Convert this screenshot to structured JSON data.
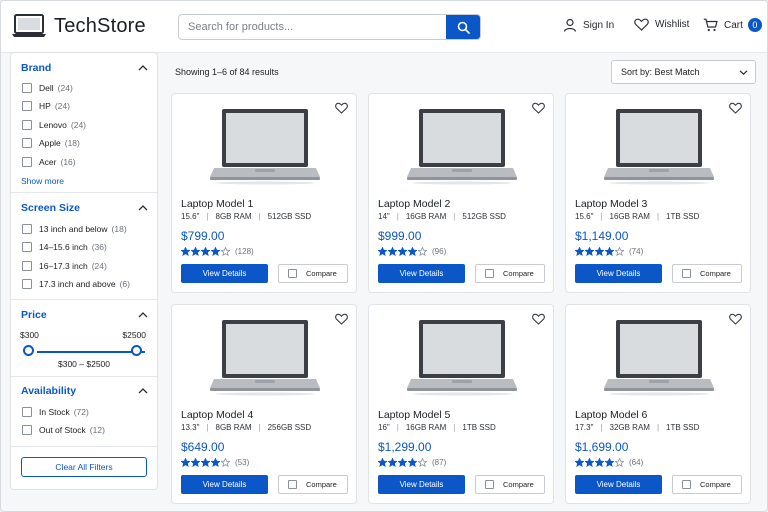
{
  "header": {
    "logo_text": "TechStore",
    "search_placeholder": "Search for products...",
    "sign_in": "Sign In",
    "wishlist": "Wishlist",
    "cart": "Cart",
    "cart_count": "0",
    "brand_color": "#0b57c7"
  },
  "sidebar": {
    "brand": {
      "title": "Brand",
      "items": [
        {
          "label": "Dell",
          "count": "(24)"
        },
        {
          "label": "HP",
          "count": "(24)"
        },
        {
          "label": "Lenovo",
          "count": "(24)"
        },
        {
          "label": "Apple",
          "count": "(18)"
        },
        {
          "label": "Acer",
          "count": "(16)"
        }
      ],
      "show_more": "Show more"
    },
    "screen_size": {
      "title": "Screen Size",
      "items": [
        {
          "label": "13 inch and below",
          "count": "(18)"
        },
        {
          "label": "14–15.6 inch",
          "count": "(36)"
        },
        {
          "label": "16–17.3 inch",
          "count": "(24)"
        },
        {
          "label": "17.3 inch and above",
          "count": "(6)"
        }
      ]
    },
    "price": {
      "title": "Price",
      "min_label": "$300",
      "max_label": "$2500",
      "range_text": "$300 – $2500"
    },
    "availability": {
      "title": "Availability",
      "items": [
        {
          "label": "In Stock",
          "count": "(72)"
        },
        {
          "label": "Out of Stock",
          "count": "(12)"
        }
      ]
    },
    "clear_all": "Clear All Filters"
  },
  "main": {
    "results_text": "Showing 1–6 of 84 results",
    "sort_label": "Sort by: Best Match",
    "view_details": "View Details",
    "compare": "Compare",
    "products": [
      {
        "name": "Laptop Model 1",
        "screen": "15.6\"",
        "ram": "8GB RAM",
        "storage": "512GB SSD",
        "price": "$799.00",
        "stars": 4,
        "reviews": "(128)"
      },
      {
        "name": "Laptop Model 2",
        "screen": "14\"",
        "ram": "16GB RAM",
        "storage": "512GB SSD",
        "price": "$999.00",
        "stars": 4,
        "reviews": "(96)"
      },
      {
        "name": "Laptop Model 3",
        "screen": "15.6\"",
        "ram": "16GB RAM",
        "storage": "1TB SSD",
        "price": "$1,149.00",
        "stars": 4,
        "reviews": "(74)"
      },
      {
        "name": "Laptop Model 4",
        "screen": "13.3\"",
        "ram": "8GB RAM",
        "storage": "256GB SSD",
        "price": "$649.00",
        "stars": 4,
        "reviews": "(53)"
      },
      {
        "name": "Laptop Model 5",
        "screen": "16\"",
        "ram": "16GB RAM",
        "storage": "1TB SSD",
        "price": "$1,299.00",
        "stars": 4,
        "reviews": "(87)"
      },
      {
        "name": "Laptop Model 6",
        "screen": "17.3\"",
        "ram": "32GB RAM",
        "storage": "1TB SSD",
        "price": "$1,699.00",
        "stars": 4,
        "reviews": "(64)"
      }
    ]
  }
}
